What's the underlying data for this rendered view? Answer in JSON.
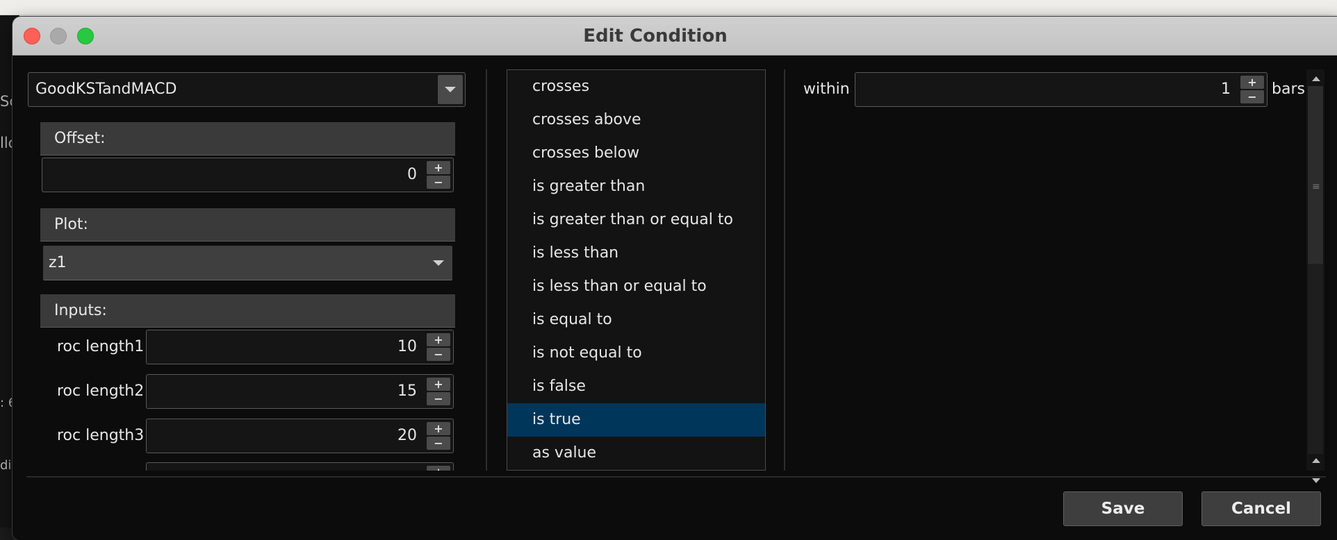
{
  "window": {
    "title": "Edit Condition"
  },
  "study": {
    "selected": "GoodKSTandMACD"
  },
  "offset": {
    "label": "Offset:",
    "value": "0"
  },
  "plot": {
    "label": "Plot:",
    "selected": "z1"
  },
  "inputs": {
    "label": "Inputs:",
    "rows": [
      {
        "label": "roc length1",
        "value": "10"
      },
      {
        "label": "roc length2",
        "value": "15"
      },
      {
        "label": "roc length3",
        "value": "20"
      }
    ]
  },
  "conditions": {
    "items": [
      "crosses",
      "crosses above",
      "crosses below",
      "is greater than",
      "is greater than or equal to",
      "is less than",
      "is less than or equal to",
      "is equal to",
      "is not equal to",
      "is false",
      "is true",
      "as value"
    ],
    "selected_index": 10
  },
  "within": {
    "label": "within",
    "value": "1",
    "unit": "bars"
  },
  "actions": {
    "save": "Save",
    "cancel": "Cancel"
  },
  "background_fragments": [
    "Sc",
    "llc",
    ": 6",
    "di:"
  ],
  "colors": {
    "selection": "#00365a",
    "window_bg": "#0c0c0c",
    "header_bg": "#3a3a3a"
  }
}
